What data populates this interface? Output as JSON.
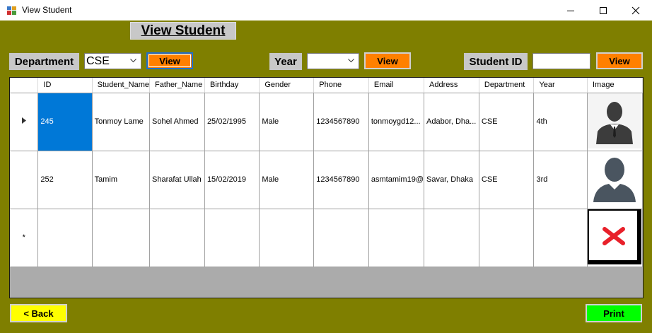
{
  "window": {
    "title": "View Student",
    "app_icon": "winforms-app-icon",
    "controls": [
      "minimize-icon",
      "maximize-icon",
      "close-icon"
    ]
  },
  "colors": {
    "form_background": "#7f7f00",
    "label_background": "#c8c8c8",
    "view_button": "#ff8000",
    "back_button": "#ffff00",
    "print_button": "#00ff00",
    "selection": "#0078d7"
  },
  "heading": "View Student",
  "filters": {
    "department_label": "Department",
    "department_value": "CSE",
    "department_view": "View",
    "year_label": "Year",
    "year_value": "",
    "year_view": "View",
    "student_id_label": "Student ID",
    "student_id_value": "",
    "student_id_view": "View"
  },
  "grid": {
    "columns": [
      "ID",
      "Student_Name",
      "Father_Name",
      "Birthday",
      "Gender",
      "Phone",
      "Email",
      "Address",
      "Department",
      "Year",
      "Image"
    ],
    "rows": [
      {
        "indicator": "current-row-arrow-icon",
        "id": "245",
        "student_name": "Tonmoy Lame",
        "father_name": "Sohel Ahmed",
        "birthday": "25/02/1995",
        "gender": "Male",
        "phone": "1234567890",
        "email": "tonmoygd12...",
        "address": "Adabor, Dha...",
        "department": "CSE",
        "year": "4th",
        "image": "businessman-avatar-icon"
      },
      {
        "indicator": "",
        "id": "252",
        "student_name": "Tamim",
        "father_name": "Sharafat Ullah",
        "birthday": "15/02/2019",
        "gender": "Male",
        "phone": "1234567890",
        "email": "asmtamim19@",
        "address": "Savar, Dhaka",
        "department": "CSE",
        "year": "3rd",
        "image": "person-avatar-icon"
      }
    ],
    "new_row": {
      "indicator": "*",
      "image": "missing-image-icon"
    }
  },
  "footer": {
    "back_label": "< Back",
    "print_label": "Print"
  }
}
